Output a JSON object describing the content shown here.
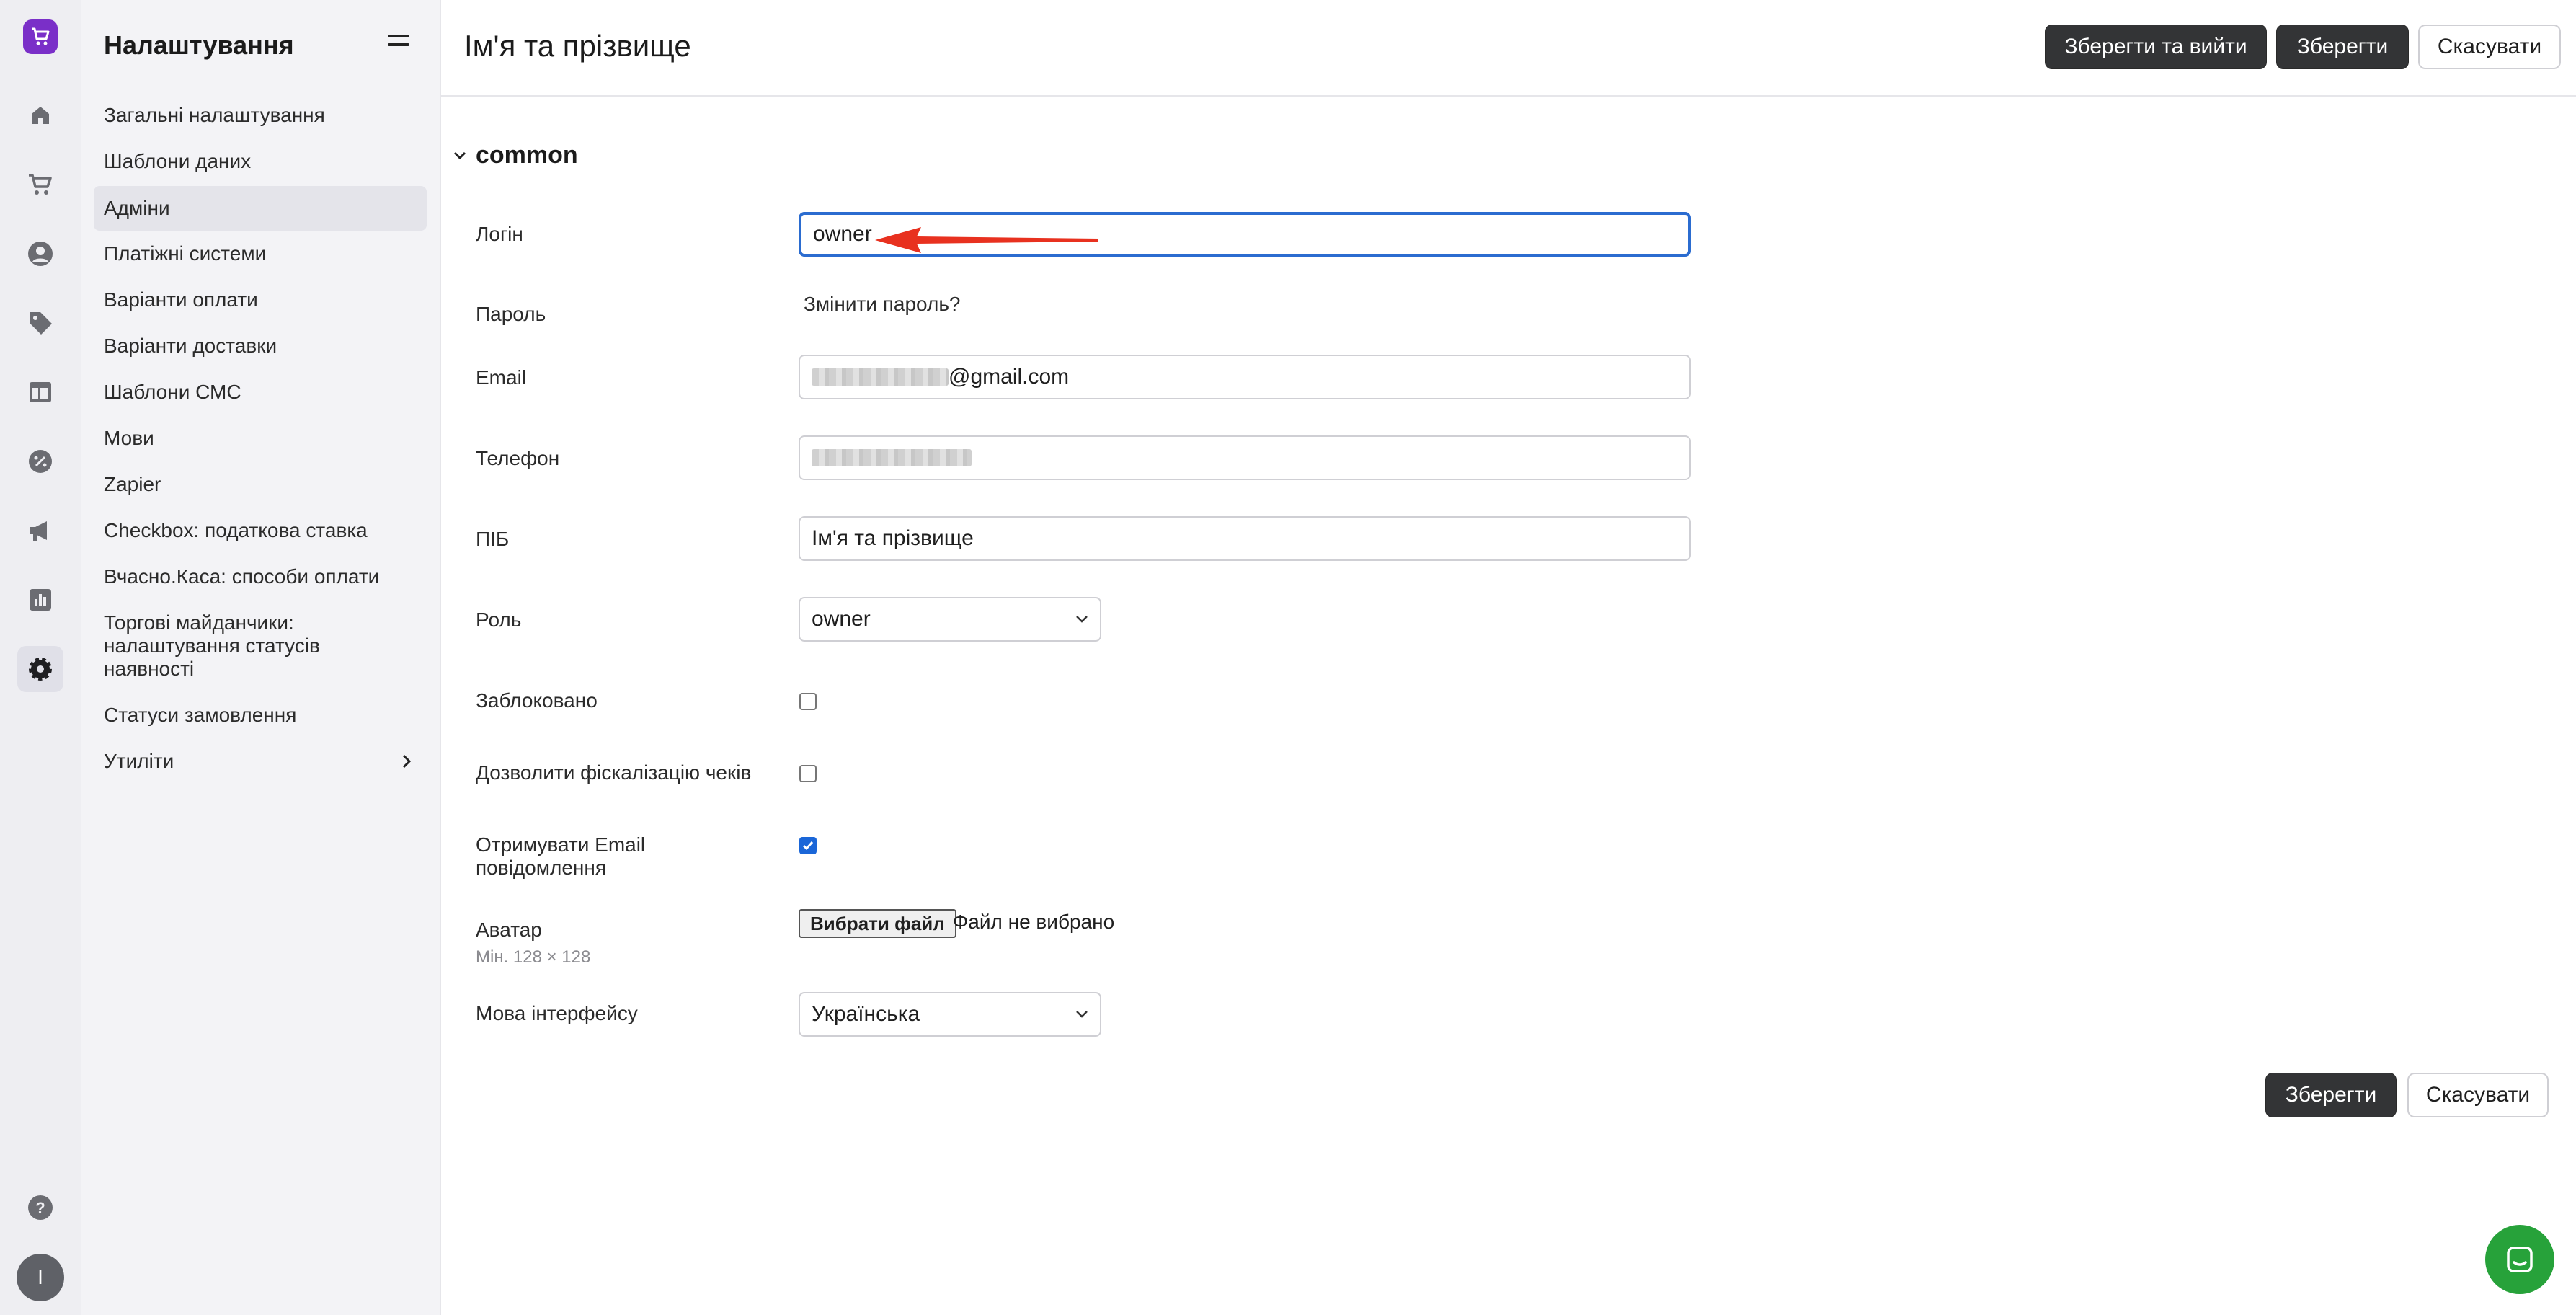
{
  "settings_nav": {
    "title": "Налаштування",
    "items": [
      {
        "label": "Загальні налаштування"
      },
      {
        "label": "Шаблони даних"
      },
      {
        "label": "Адміни"
      },
      {
        "label": "Платіжні системи"
      },
      {
        "label": "Варіанти оплати"
      },
      {
        "label": "Варіанти доставки"
      },
      {
        "label": "Шаблони СМС"
      },
      {
        "label": "Мови"
      },
      {
        "label": "Zapier"
      },
      {
        "label": "Checkbox: податкова ставка"
      },
      {
        "label": "Вчасно.Каса: способи оплати"
      },
      {
        "label": "Торгові майданчики: налаштування статусів наявності"
      },
      {
        "label": "Статуси замовлення"
      },
      {
        "label": "Утиліти"
      }
    ]
  },
  "rail": {
    "icons": [
      "cart-logo-icon",
      "home-icon",
      "shopping-cart-icon",
      "user-circle-icon",
      "tag-icon",
      "layout-icon",
      "discount-icon",
      "megaphone-icon",
      "bar-chart-icon",
      "settings-gear-icon",
      "help-icon"
    ],
    "avatar_initial": "I"
  },
  "header": {
    "title": "Ім'я та прізвище",
    "save_exit": "Зберегти та вийти",
    "save": "Зберегти",
    "cancel": "Скасувати"
  },
  "form": {
    "section": "common",
    "login_label": "Логін",
    "login_value": "owner",
    "password_label": "Пароль",
    "password_link": "Змінити пароль?",
    "email_label": "Email",
    "email_suffix": "@gmail.com",
    "phone_label": "Телефон",
    "fullname_label": "ПІБ",
    "fullname_value": "Ім'я та прізвище",
    "role_label": "Роль",
    "role_value": "owner",
    "blocked_label": "Заблоковано",
    "blocked": false,
    "fiscal_label": "Дозволити фіскалізацію чеків",
    "fiscal": false,
    "email_notify_label": "Отримувати Email повідомлення",
    "email_notify": true,
    "avatar_label": "Аватар",
    "avatar_hint": "Мін. 128 × 128",
    "choose_file": "Вибрати файл",
    "no_file": "Файл не вибрано",
    "language_label": "Мова інтерфейсу",
    "language_value": "Українська"
  },
  "footer": {
    "save": "Зберегти",
    "cancel": "Скасувати"
  },
  "colors": {
    "brand": "#7a2fc8",
    "dark_button": "#333436",
    "focus": "#2b6cd0",
    "arrow": "#e8311f",
    "chat": "#27a23a"
  }
}
